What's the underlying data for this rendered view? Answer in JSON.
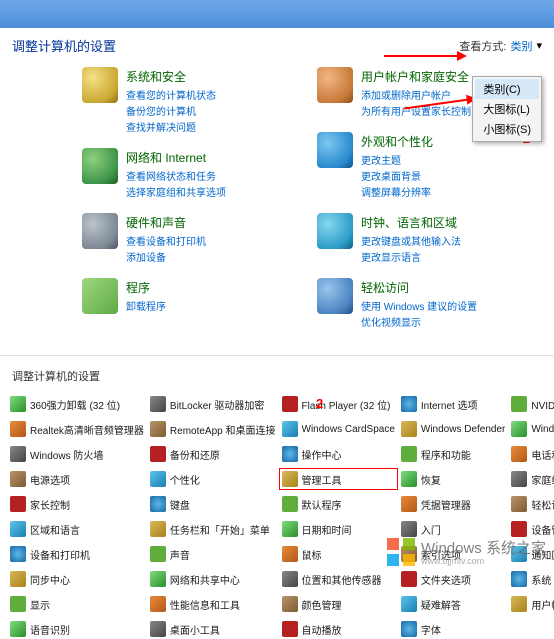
{
  "header": {
    "title": "调整计算机的设置"
  },
  "view": {
    "label": "查看方式:",
    "current": "类别",
    "options": [
      "类别(C)",
      "大图标(L)",
      "小图标(S)"
    ]
  },
  "annotations": {
    "num1": "1",
    "num2": "2"
  },
  "categories": {
    "left": [
      {
        "title": "系统和安全",
        "links": [
          "查看您的计算机状态",
          "备份您的计算机",
          "查找并解决问题"
        ]
      },
      {
        "title": "网络和 Internet",
        "links": [
          "查看网络状态和任务",
          "选择家庭组和共享选项"
        ]
      },
      {
        "title": "硬件和声音",
        "links": [
          "查看设备和打印机",
          "添加设备"
        ]
      },
      {
        "title": "程序",
        "links": [
          "卸载程序"
        ]
      }
    ],
    "right": [
      {
        "title": "用户帐户和家庭安全",
        "links": [
          "添加或删除用户帐户",
          "为所有用户设置家长控制"
        ]
      },
      {
        "title": "外观和个性化",
        "links": [
          "更改主题",
          "更改桌面背景",
          "调整屏幕分辨率"
        ]
      },
      {
        "title": "时钟、语言和区域",
        "links": [
          "更改键盘或其他输入法",
          "更改显示语言"
        ]
      },
      {
        "title": "轻松访问",
        "links": [
          "使用 Windows 建议的设置",
          "优化视频显示"
        ]
      }
    ]
  },
  "lower": {
    "title": "调整计算机的设置"
  },
  "applets": [
    "360强力卸载 (32 位)",
    "BitLocker 驱动器加密",
    "Flash Player (32 位)",
    "Internet 选项",
    "NVIDIA 控制面板",
    "Realtek高清晰音频管理器",
    "RemoteApp 和桌面连接",
    "Windows CardSpace",
    "Windows Defender",
    "Windows Update",
    "Windows 防火墙",
    "备份和还原",
    "操作中心",
    "程序和功能",
    "电话和调制解调器",
    "电源选项",
    "个性化",
    "管理工具",
    "恢复",
    "家庭组",
    "家长控制",
    "键盘",
    "默认程序",
    "凭据管理器",
    "轻松访问中心",
    "区域和语言",
    "任务栏和「开始」菜单",
    "日期和时间",
    "入门",
    "设备管理器",
    "设备和打印机",
    "声音",
    "鼠标",
    "索引选项",
    "通知区域图标",
    "同步中心",
    "网络和共享中心",
    "位置和其他传感器",
    "文件夹选项",
    "系统",
    "显示",
    "性能信息和工具",
    "颜色管理",
    "疑难解答",
    "用户帐户",
    "语音识别",
    "桌面小工具",
    "自动播放",
    "字体",
    ""
  ],
  "watermark": {
    "brand": "Windows",
    "sub": "系统之家",
    "url": "www.bjjmlv.com"
  },
  "colors": {
    "accent": "#0066cc",
    "cat_title": "#006400",
    "annotation": "#ff0000"
  }
}
